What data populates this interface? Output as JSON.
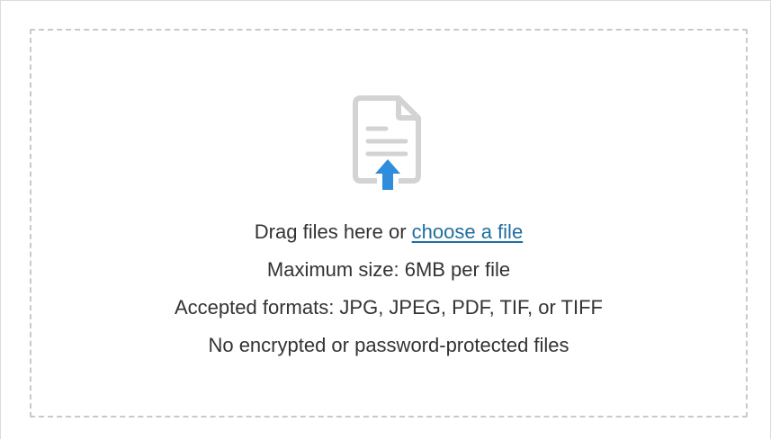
{
  "dropzone": {
    "drag_text": "Drag files here or",
    "choose_link": "choose a file",
    "max_size": "Maximum size: 6MB per file",
    "formats": "Accepted formats: JPG, JPEG, PDF, TIF, or TIFF",
    "restriction": "No encrypted or password-protected files"
  },
  "icons": {
    "upload": "file-upload-icon"
  },
  "colors": {
    "link": "#1f6f9f",
    "arrow": "#2f8ddb",
    "dashed_border": "#c9c9c9",
    "text": "#333333"
  }
}
